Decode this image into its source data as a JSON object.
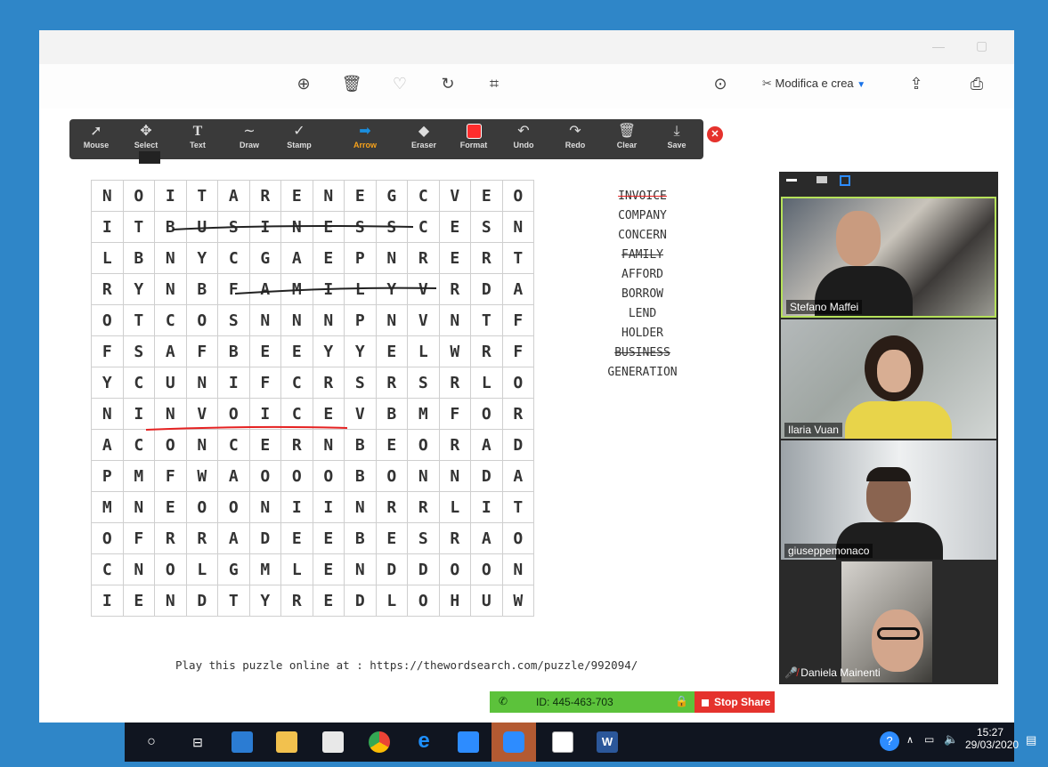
{
  "viewer": {
    "edit_label": "Modifica e crea"
  },
  "annotation_toolbar": {
    "tools": [
      {
        "label": "Mouse"
      },
      {
        "label": "Select"
      },
      {
        "label": "Text"
      },
      {
        "label": "Draw"
      },
      {
        "label": "Stamp"
      },
      {
        "label": "Arrow"
      },
      {
        "label": "Eraser"
      },
      {
        "label": "Format"
      },
      {
        "label": "Undo"
      },
      {
        "label": "Redo"
      },
      {
        "label": "Clear"
      },
      {
        "label": "Save"
      }
    ],
    "active_tool": "Arrow"
  },
  "puzzle": {
    "rows": [
      "NOITARENEGCVEO",
      "ITBUSINESSCESN",
      "LBNYCGAEPNRERT",
      "RYNBFAMILYVRDA",
      "OTCOSNNNPNVNTF",
      "FSAFBEEYYELWRF",
      "YCUNIFCRSRSRLO",
      "NINVOICEVBMFOR",
      "ACONCERNBEORAD",
      "PMFWAOOOBONNDA",
      "MNEOONIINRRLIT",
      "OFRRADEEBESRAO",
      "CNOLGMLENDDOON",
      "IENDTYREDLOHUW"
    ],
    "words": [
      {
        "text": "INVOICE",
        "found": true
      },
      {
        "text": "COMPANY",
        "found": false
      },
      {
        "text": "CONCERN",
        "found": false
      },
      {
        "text": "FAMILY",
        "found": true
      },
      {
        "text": "AFFORD",
        "found": false
      },
      {
        "text": "BORROW",
        "found": false
      },
      {
        "text": "LEND",
        "found": false
      },
      {
        "text": "HOLDER",
        "found": false
      },
      {
        "text": "BUSINESS",
        "found": true
      },
      {
        "text": "GENERATION",
        "found": false
      }
    ],
    "footer": "Play this puzzle online at : https://thewordsearch.com/puzzle/992094/"
  },
  "participants": [
    {
      "name": "Stefano Maffei"
    },
    {
      "name": "Ilaria Vuan"
    },
    {
      "name": "giuseppemonaco"
    },
    {
      "name": "Daniela Mainenti"
    }
  ],
  "share": {
    "meeting_id": "ID: 445-463-703",
    "stop_label": "Stop Share"
  },
  "taskbar": {
    "time": "15:27",
    "date": "29/03/2020"
  }
}
